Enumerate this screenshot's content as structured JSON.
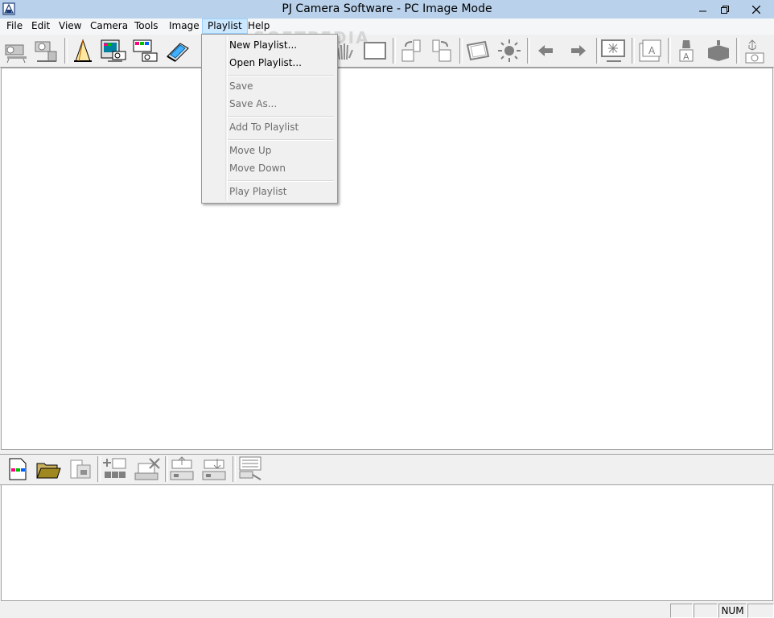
{
  "window": {
    "title": "PJ Camera Software - PC Image Mode"
  },
  "menubar": {
    "items": [
      "File",
      "Edit",
      "View",
      "Camera",
      "Tools",
      "Image",
      "Playlist",
      "Help"
    ],
    "active": "Playlist"
  },
  "playlist_menu": {
    "items": [
      {
        "label": "New Playlist...",
        "enabled": true
      },
      {
        "label": "Open Playlist...",
        "enabled": true
      },
      {
        "label": "Save",
        "enabled": false
      },
      {
        "label": "Save As...",
        "enabled": false
      },
      {
        "label": "Add To Playlist",
        "enabled": false
      },
      {
        "label": "Move Up",
        "enabled": false
      },
      {
        "label": "Move Down",
        "enabled": false
      },
      {
        "label": "Play Playlist",
        "enabled": false
      }
    ]
  },
  "statusbar": {
    "num_indicator": "NUM"
  },
  "colors": {
    "titlebar": "#b9d1ea",
    "menu_highlight": "#cce8ff",
    "pane_background": "#ffffff",
    "chrome": "#f0f0f0"
  }
}
